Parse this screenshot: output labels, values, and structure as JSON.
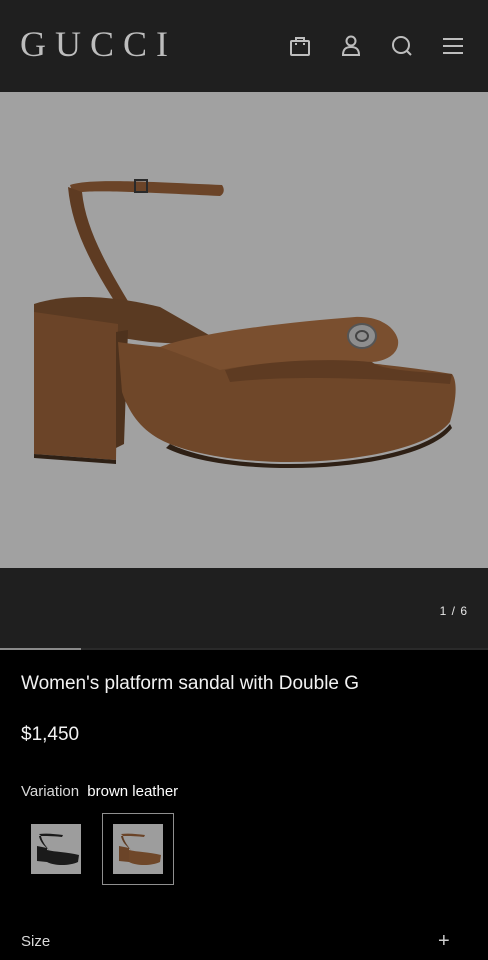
{
  "header": {
    "logo": "GUCCI",
    "icons": [
      "shopping-bag-icon",
      "account-icon",
      "search-icon",
      "menu-icon"
    ]
  },
  "gallery": {
    "counter": "1 / 6",
    "progress": 0.1667
  },
  "product": {
    "title": "Women's platform sandal with Double G",
    "price": "$1,450",
    "variation_label": "Variation",
    "variation_value": "brown leather",
    "swatches": [
      {
        "color": "black",
        "selected": false
      },
      {
        "color": "brown",
        "selected": true
      }
    ]
  },
  "size": {
    "label": "Size",
    "expand_symbol": "+"
  },
  "colors": {
    "header_bg": "#1f1f1f",
    "page_bg": "#000000",
    "image_bg": "#a1a1a1",
    "sandal_brown": "#6b4428"
  }
}
